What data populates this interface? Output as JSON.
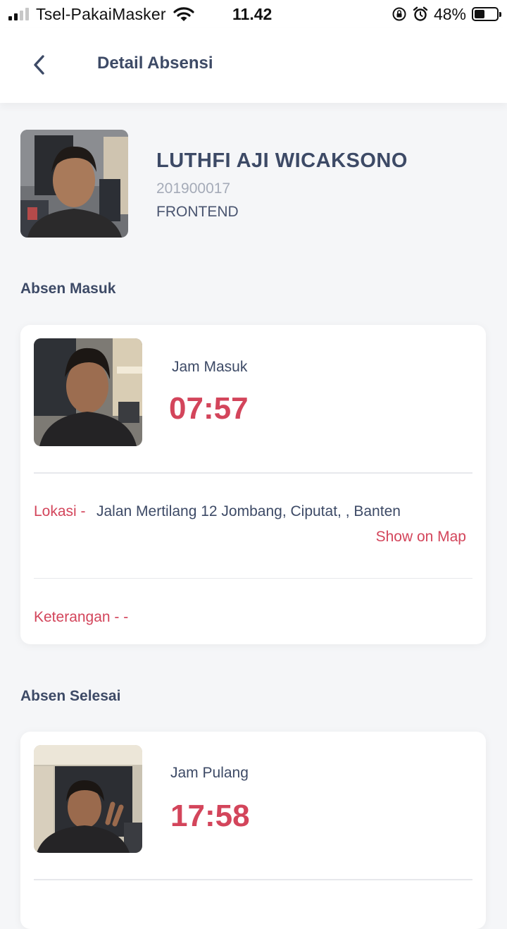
{
  "status_bar": {
    "carrier": "Tsel-PakaiMasker",
    "time": "11.42",
    "battery_percent": "48%",
    "battery_level": 0.48,
    "icons": [
      "signal-icon",
      "wifi-icon",
      "rotation-lock-icon",
      "alarm-icon",
      "battery-icon"
    ]
  },
  "header": {
    "title": "Detail Absensi",
    "back_icon": "chevron-left-icon"
  },
  "employee": {
    "name": "LUTHFI AJI WICAKSONO",
    "id": "201900017",
    "department": "FRONTEND"
  },
  "absen_masuk": {
    "section_title": "Absen Masuk",
    "time_label": "Jam Masuk",
    "time": "07:57",
    "location_label": "Lokasi -",
    "location": "Jalan Mertilang 12 Jombang, Ciputat, , Banten",
    "map_link": "Show on Map",
    "note_label": "Keterangan - -"
  },
  "absen_selesai": {
    "section_title": "Absen Selesai",
    "time_label": "Jam Pulang",
    "time": "17:58"
  },
  "colors": {
    "accent": "#d3455b",
    "text_primary": "#3d4a66",
    "text_muted": "#a5abb8",
    "background": "#f5f6f8"
  }
}
